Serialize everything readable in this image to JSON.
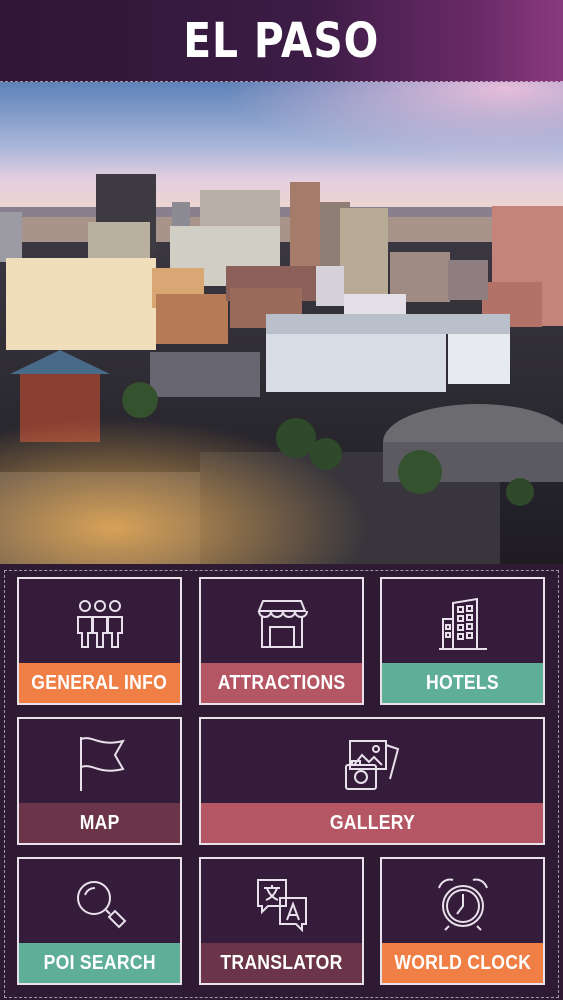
{
  "header": {
    "title": "EL PASO"
  },
  "hero": {
    "alt": "El Paso skyline at dusk"
  },
  "menu": {
    "tiles": [
      {
        "label": "GENERAL INFO",
        "icon": "people-icon",
        "color": "#f07f45"
      },
      {
        "label": "ATTRACTIONS",
        "icon": "store-icon",
        "color": "#b45664"
      },
      {
        "label": "HOTELS",
        "icon": "building-icon",
        "color": "#5fae98"
      },
      {
        "label": "MAP",
        "icon": "flag-icon",
        "color": "#6b3448"
      },
      {
        "label": "GALLERY",
        "icon": "photos-icon",
        "color": "#b45664"
      },
      {
        "label": "POI SEARCH",
        "icon": "magnifier-icon",
        "color": "#5fae98"
      },
      {
        "label": "TRANSLATOR",
        "icon": "translate-icon",
        "color": "#6b3448"
      },
      {
        "label": "WORLD CLOCK",
        "icon": "alarm-clock-icon",
        "color": "#f07f45"
      }
    ]
  }
}
